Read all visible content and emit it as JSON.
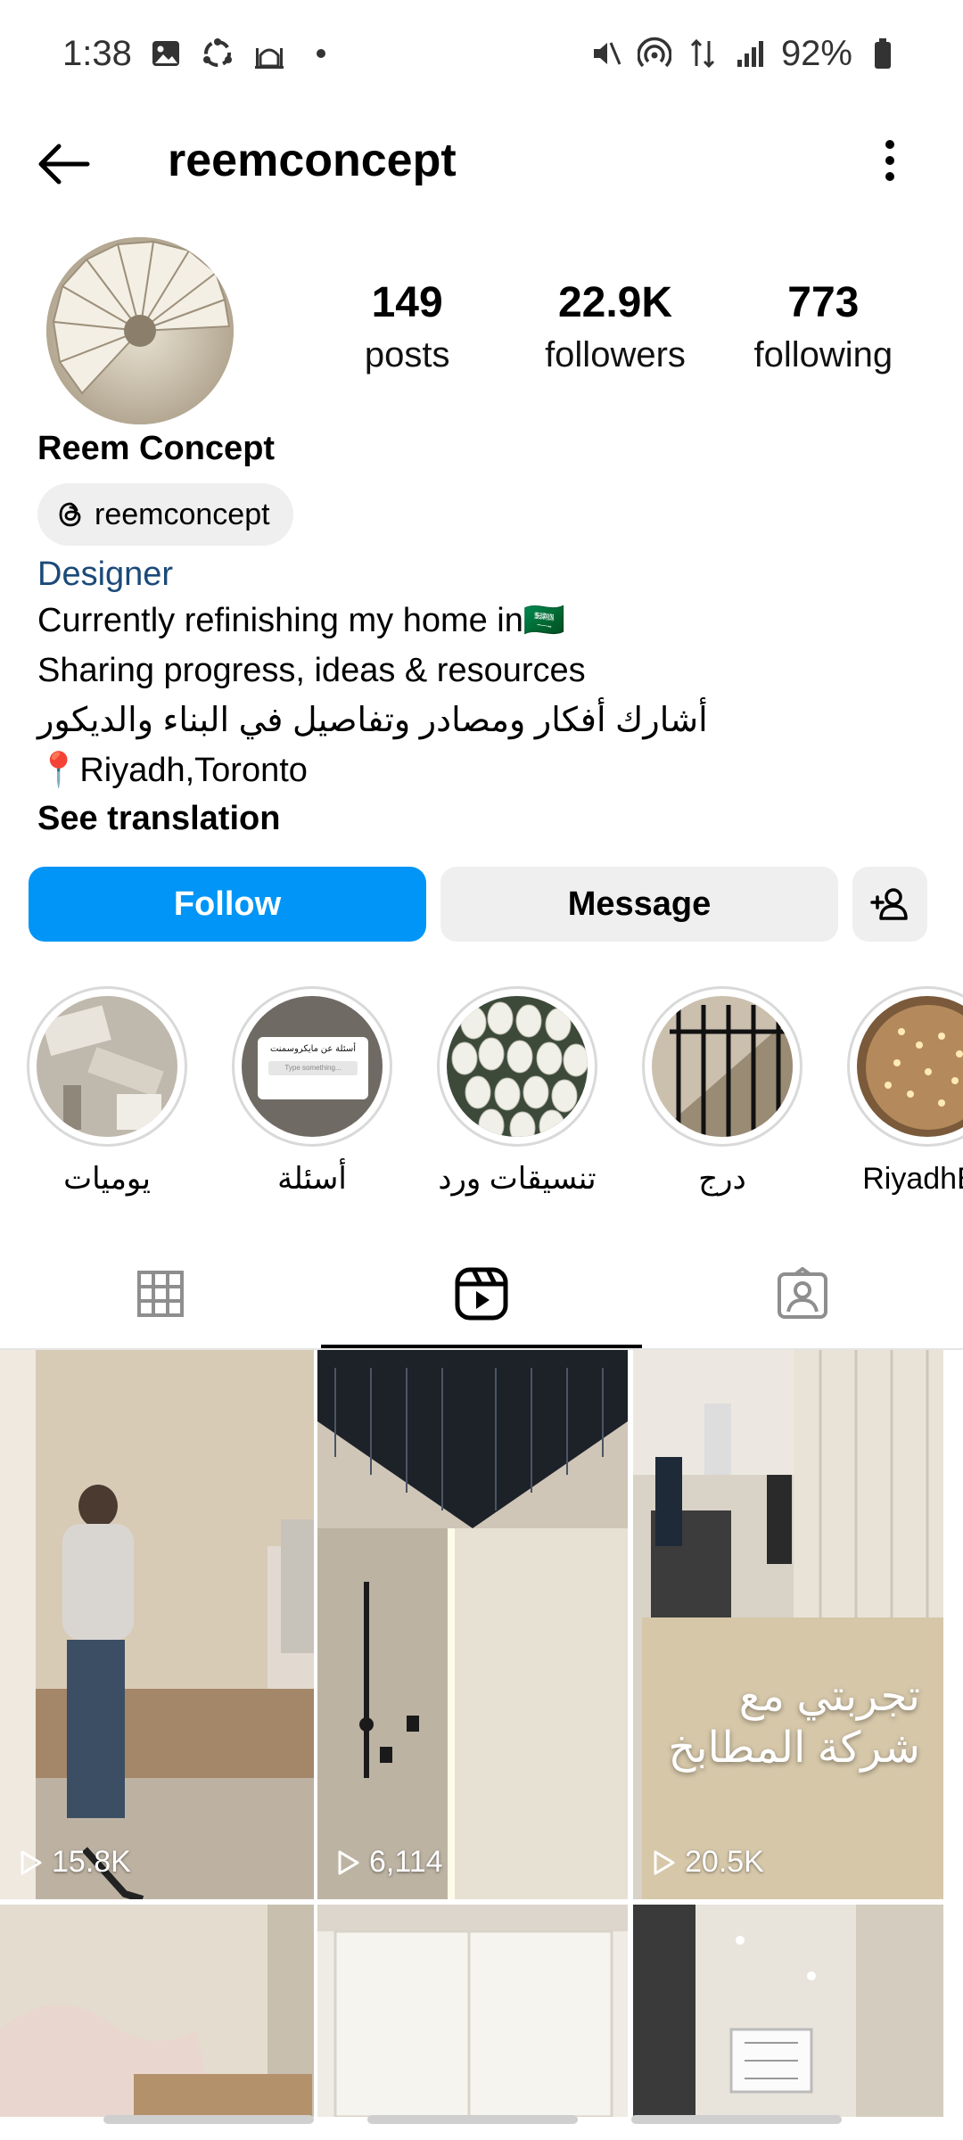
{
  "status_bar": {
    "time": "1:38",
    "battery": "92%",
    "left_icons": [
      "gallery-icon",
      "sync-icon",
      "mosque-icon",
      "dot-icon"
    ],
    "right_icons": [
      "mute-icon",
      "hotspot-icon",
      "data-icon",
      "signal-icon",
      "battery-icon"
    ]
  },
  "header": {
    "username": "reemconcept"
  },
  "profile": {
    "stats": [
      {
        "value": "149",
        "label": "posts"
      },
      {
        "value": "22.9K",
        "label": "followers"
      },
      {
        "value": "773",
        "label": "following"
      }
    ],
    "full_name": "Reem Concept",
    "threads_handle": "reemconcept",
    "category": "Designer",
    "bio": {
      "line1": "Currently refinishing my home in",
      "line1_flag": "🇸🇦",
      "line2": "Sharing progress, ideas & resources",
      "line3": "أشارك أفكار ومصادر وتفاصيل في البناء والديكور",
      "line4_pin": "📍",
      "line4": "Riyadh,Toronto"
    },
    "see_translation": "See translation"
  },
  "actions": {
    "follow": "Follow",
    "message": "Message"
  },
  "highlights": [
    {
      "label": "يوميات"
    },
    {
      "label": "أسئلة",
      "card_title": "أسئلة عن مايكروسمنت",
      "card_placeholder": "Type something..."
    },
    {
      "label": "تنسيقات ورد"
    },
    {
      "label": "درج"
    },
    {
      "label": "RiyadhEv"
    }
  ],
  "tabs": [
    "grid-icon",
    "reels-icon",
    "tagged-icon"
  ],
  "reels": [
    {
      "views": "15.8K"
    },
    {
      "views": "6,114"
    },
    {
      "views": "20.5K",
      "overlay_line1": "تجربتي مع",
      "overlay_line2": "شركة المطابخ"
    },
    {
      "views": ""
    },
    {
      "views": ""
    },
    {
      "views": ""
    }
  ]
}
